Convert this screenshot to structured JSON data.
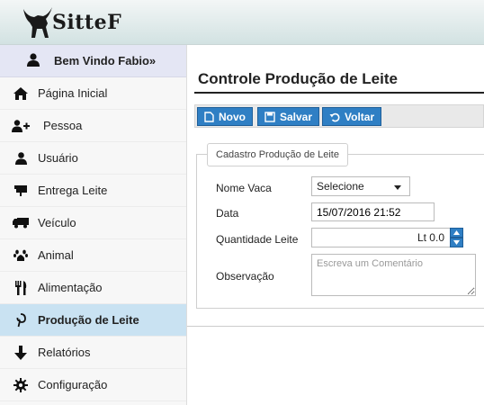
{
  "app": {
    "logo_text": "SitteF"
  },
  "sidebar": {
    "welcome": "Bem Vindo Fabio»",
    "items": [
      {
        "label": "Página Inicial",
        "icon": "home-icon"
      },
      {
        "label": "Pessoa",
        "icon": "user-plus-icon"
      },
      {
        "label": "Usuário",
        "icon": "user-icon"
      },
      {
        "label": "Entrega Leite",
        "icon": "delivery-icon"
      },
      {
        "label": "Veículo",
        "icon": "truck-icon"
      },
      {
        "label": "Animal",
        "icon": "paw-icon"
      },
      {
        "label": "Alimentação",
        "icon": "cutlery-icon"
      },
      {
        "label": "Produção de Leite",
        "icon": "pinterest-icon",
        "active": true
      },
      {
        "label": "Relatórios",
        "icon": "arrow-down-icon"
      },
      {
        "label": "Configuração",
        "icon": "gear-icon"
      }
    ]
  },
  "main": {
    "title": "Controle Produção de Leite",
    "toolbar": {
      "new_label": "Novo",
      "save_label": "Salvar",
      "back_label": "Voltar"
    },
    "form": {
      "legend": "Cadastro Produção de Leite",
      "cow_label": "Nome Vaca",
      "cow_value": "Selecione",
      "date_label": "Data",
      "date_value": "15/07/2016 21:52",
      "qty_label": "Quantidade Leite",
      "qty_value": "Lt 0.0",
      "obs_label": "Observação",
      "obs_placeholder": "Escreva um Comentário"
    }
  },
  "colors": {
    "accent": "#2f7fc4",
    "active_item": "#c9e2f2",
    "welcome_bg": "#e4e6f4"
  }
}
